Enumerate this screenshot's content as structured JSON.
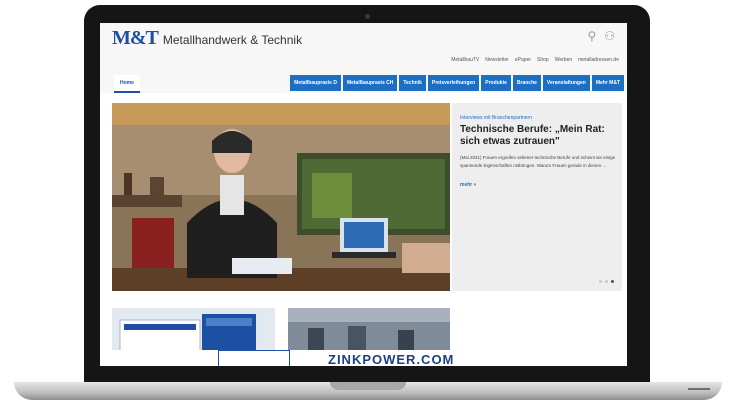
{
  "site": {
    "logo_mark": "M&T",
    "logo_text": "Metallhandwerk & Technik"
  },
  "header_icons": [
    {
      "name": "search-icon",
      "glyph": "⚲"
    },
    {
      "name": "user-icon",
      "glyph": "⚇"
    }
  ],
  "top_links": [
    "MetallbauTV",
    "Newsletter",
    "ePaper",
    "Shop",
    "Werben",
    "metalladressen.de"
  ],
  "nav": {
    "home": "Home",
    "items": [
      "Metallbaupraxis D",
      "Metallbaupraxis CH",
      "Technik",
      "Preisverleihungen",
      "Produkte",
      "Branche",
      "Veranstaltungen",
      "Mehr M&T"
    ]
  },
  "teaser": {
    "kicker": "Interviews mit Branchenpartnern",
    "headline": "Technische Berufe: „Mein Rat: sich etwas zutrauen\"",
    "excerpt": "(Mai 2021) Frauen ergreifen seltener technische Berufe und scheint sie einige spannende Eigenschaften mitbringen. Warum Frauen gerade in diesen ...",
    "more": "mehr »"
  },
  "ad": {
    "text": "ZINKPOWER.COM"
  },
  "colors": {
    "brand_blue": "#1d4fa3",
    "nav_blue": "#1d6fc4"
  }
}
